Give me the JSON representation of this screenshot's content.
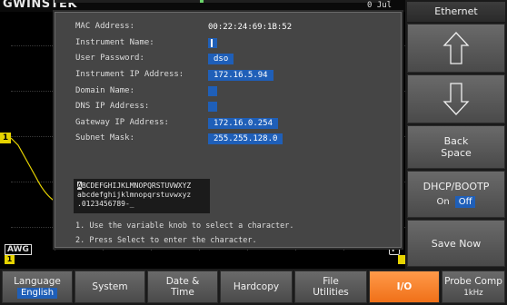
{
  "header": {
    "logo": "GWINSTEK",
    "date_fragment": "0 Jul"
  },
  "scope": {
    "ch1_marker": "1",
    "awg_badge": "AWG",
    "f_badge": "F",
    "colors": {
      "trace": "#e6d300",
      "grid": "#3a3a3a",
      "accent": "#1f5fb8",
      "active_tab": "#f07018"
    }
  },
  "dialog": {
    "fields": [
      {
        "label": "MAC Address:",
        "value": "00:22:24:69:1B:52"
      },
      {
        "label": "Instrument Name:",
        "value": ""
      },
      {
        "label": "User Password:",
        "value": "dso"
      },
      {
        "label": "Instrument IP Address:",
        "value": "172.16.5.94"
      },
      {
        "label": "Domain Name:",
        "value": ""
      },
      {
        "label": "DNS IP Address:",
        "value": ""
      },
      {
        "label": "Gateway IP Address:",
        "value": "172.16.0.254"
      },
      {
        "label": "Subnet Mask:",
        "value": "255.255.128.0"
      }
    ],
    "charset": {
      "selected_char": "A",
      "line1_rest": "BCDEFGHIJKLMNOPQRSTUVWXYZ",
      "line2": "abcdefghijklmnopqrstuvwxyz",
      "line3": ".0123456789-_"
    },
    "instructions": [
      "1. Use the variable knob to select a character.",
      "2. Press Select to enter the character."
    ]
  },
  "side_menu": {
    "title": "Ethernet",
    "up_icon": "arrow-up-icon",
    "down_icon": "arrow-down-icon",
    "backspace_line1": "Back",
    "backspace_line2": "Space",
    "dhcp_label": "DHCP/BOOTP",
    "dhcp_on": "On",
    "dhcp_off": "Off",
    "save_now": "Save Now"
  },
  "bottom_menu": {
    "language_label": "Language",
    "language_value": "English",
    "system": "System",
    "datetime_line1": "Date &",
    "datetime_line2": "Time",
    "hardcopy": "Hardcopy",
    "file_line1": "File",
    "file_line2": "Utilities",
    "io": "I/O",
    "probe_label": "Probe Comp",
    "probe_value": "1kHz"
  }
}
